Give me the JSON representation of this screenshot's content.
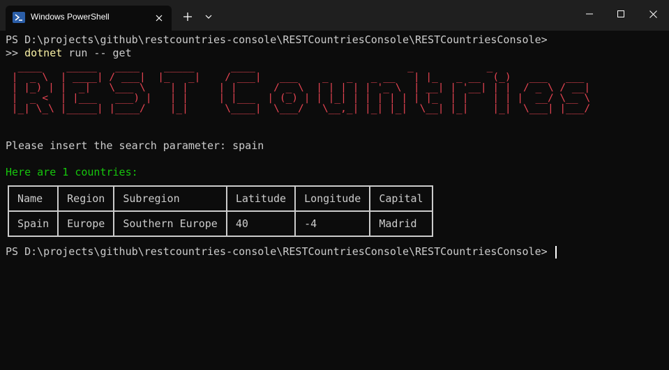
{
  "window": {
    "tab_title": "Windows PowerShell",
    "icons": {
      "tab": "powershell-icon",
      "close_tab": "close-icon",
      "new_tab": "plus-icon",
      "dropdown": "chevron-down-icon",
      "minimize": "minimize-icon",
      "maximize": "maximize-icon",
      "close": "close-icon"
    }
  },
  "terminal": {
    "prompt1": "PS D:\\projects\\github\\restcountries-console\\RESTCountriesConsole\\RESTCountriesConsole>",
    "cont_prefix": ">> ",
    "cmd_exe": "dotnet",
    "cmd_args": " run -- get",
    "banner": [
      "  ____    _____   ____    _____      ____                         _            _",
      " |  _ \\  | ____| / ___|  |_   _|    / ___|   ___    _   _   _ __   | |_   _ __  (_)   ___   ___",
      " | |_) | |  _|   \\___ \\    | |     | |      / _ \\  | | | | | '_ \\  | __| | '__| | |  / _ \\ / __|",
      " |  _ <  | |___   ___) |   | |     | |___  | (_) | | |_| | | | | | | |_  | |    | | |  __/ \\__ \\",
      " |_| \\_\\ |_____| |____/    |_|      \\____|  \\___/   \\__,_| |_| |_|  \\__| |_|    |_|  \\___| |___/"
    ],
    "search_prompt": "Please insert the search parameter: spain",
    "result_header": "Here are 1 countries:",
    "table": {
      "headers": [
        "Name",
        "Region",
        "Subregion",
        "Latitude",
        "Longitude",
        "Capital"
      ],
      "rows": [
        [
          "Spain",
          "Europe",
          "Southern Europe",
          "40",
          "-4",
          "Madrid"
        ]
      ]
    },
    "prompt2": "PS D:\\projects\\github\\restcountries-console\\RESTCountriesConsole\\RESTCountriesConsole> "
  },
  "colors": {
    "background": "#0c0c0c",
    "titlebar": "#1f1f1f",
    "text": "#cccccc",
    "banner": "#e64452",
    "success": "#16c60c",
    "command": "#f9f1a5"
  }
}
